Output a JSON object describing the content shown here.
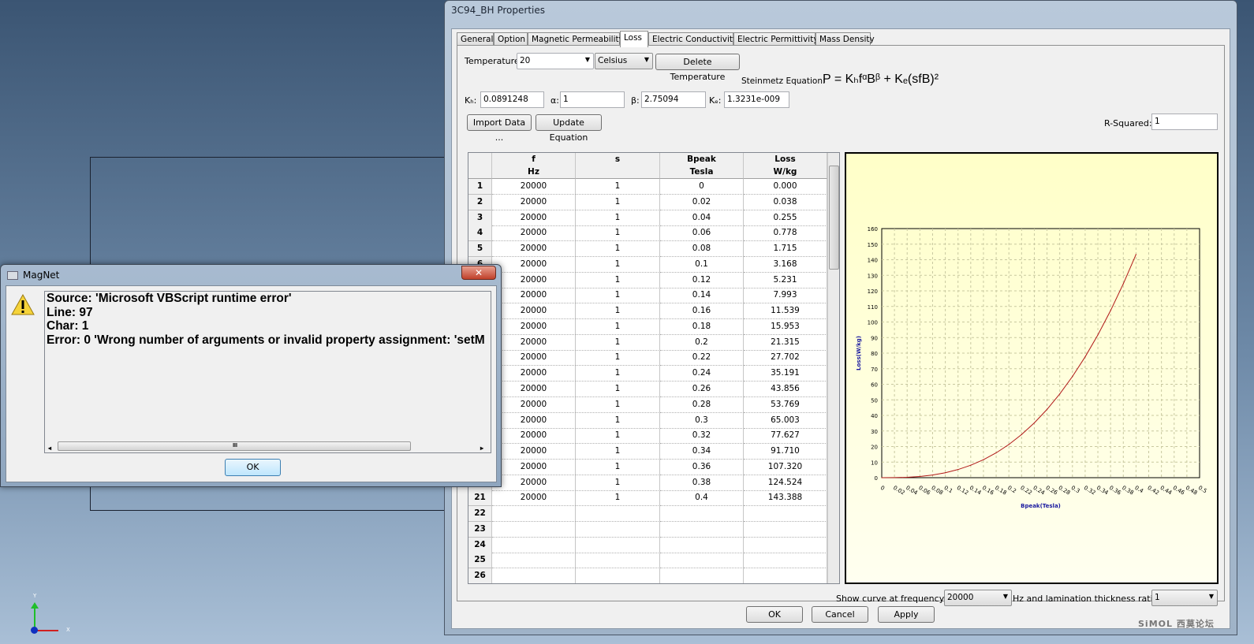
{
  "window": {
    "title": "3C94_BH Properties"
  },
  "tabs": [
    "General",
    "Option",
    "Magnetic Permeability",
    "Loss",
    "Electric Conductivity",
    "Electric Permittivity",
    "Mass Density"
  ],
  "active_tab": "Loss",
  "temperature": {
    "label": "Temperature:",
    "value": "20",
    "unit": "Celsius",
    "delete_label": "Delete Temperature"
  },
  "equation": {
    "label": "Steinmetz Equation:",
    "formula": "P = KₕfᵅBᵝ + Kₑ(sfB)²"
  },
  "params": {
    "kh_label": "Kₕ:",
    "kh": "0.0891248",
    "alpha_label": "α:",
    "alpha": "1",
    "beta_label": "β:",
    "beta": "2.75094",
    "ke_label": "Kₑ:",
    "ke": "1.3231e-009"
  },
  "buttons": {
    "import": "Import Data ...",
    "update": "Update Equation",
    "ok": "OK",
    "cancel": "Cancel",
    "apply": "Apply"
  },
  "rsquared": {
    "label": "R-Squared:",
    "value": "1"
  },
  "table": {
    "columns": [
      {
        "name": "f",
        "unit": "Hz"
      },
      {
        "name": "s",
        "unit": ""
      },
      {
        "name": "Bpeak",
        "unit": "Tesla"
      },
      {
        "name": "Loss",
        "unit": "W/kg"
      }
    ],
    "rows": [
      [
        "20000",
        "1",
        "0",
        "0.000"
      ],
      [
        "20000",
        "1",
        "0.02",
        "0.038"
      ],
      [
        "20000",
        "1",
        "0.04",
        "0.255"
      ],
      [
        "20000",
        "1",
        "0.06",
        "0.778"
      ],
      [
        "20000",
        "1",
        "0.08",
        "1.715"
      ],
      [
        "20000",
        "1",
        "0.1",
        "3.168"
      ],
      [
        "20000",
        "1",
        "0.12",
        "5.231"
      ],
      [
        "20000",
        "1",
        "0.14",
        "7.993"
      ],
      [
        "20000",
        "1",
        "0.16",
        "11.539"
      ],
      [
        "20000",
        "1",
        "0.18",
        "15.953"
      ],
      [
        "20000",
        "1",
        "0.2",
        "21.315"
      ],
      [
        "20000",
        "1",
        "0.22",
        "27.702"
      ],
      [
        "20000",
        "1",
        "0.24",
        "35.191"
      ],
      [
        "20000",
        "1",
        "0.26",
        "43.856"
      ],
      [
        "20000",
        "1",
        "0.28",
        "53.769"
      ],
      [
        "20000",
        "1",
        "0.3",
        "65.003"
      ],
      [
        "20000",
        "1",
        "0.32",
        "77.627"
      ],
      [
        "20000",
        "1",
        "0.34",
        "91.710"
      ],
      [
        "20000",
        "1",
        "0.36",
        "107.320"
      ],
      [
        "20000",
        "1",
        "0.38",
        "124.524"
      ],
      [
        "20000",
        "1",
        "0.4",
        "143.388"
      ]
    ],
    "empty_row_numbers": [
      "22",
      "23",
      "24",
      "25",
      "26"
    ]
  },
  "chart_data": {
    "type": "line",
    "xlabel": "Bpeak(Tesla)",
    "ylabel": "Loss(W/kg)",
    "xlim": [
      0,
      0.5
    ],
    "ylim": [
      0,
      160
    ],
    "x_ticks": [
      "0",
      "0.02",
      "0.04",
      "0.06",
      "0.08",
      "0.1",
      "0.12",
      "0.14",
      "0.16",
      "0.18",
      "0.2",
      "0.22",
      "0.24",
      "0.26",
      "0.28",
      "0.3",
      "0.32",
      "0.34",
      "0.36",
      "0.38",
      "0.4",
      "0.42",
      "0.44",
      "0.46",
      "0.48",
      "0.5"
    ],
    "y_ticks": [
      "0",
      "10",
      "20",
      "30",
      "40",
      "50",
      "60",
      "70",
      "80",
      "90",
      "100",
      "110",
      "120",
      "130",
      "140",
      "150",
      "160"
    ],
    "grid": true,
    "line_color": "#b01818",
    "x": [
      0,
      0.02,
      0.04,
      0.06,
      0.08,
      0.1,
      0.12,
      0.14,
      0.16,
      0.18,
      0.2,
      0.22,
      0.24,
      0.26,
      0.28,
      0.3,
      0.32,
      0.34,
      0.36,
      0.38,
      0.4
    ],
    "y": [
      0,
      0.038,
      0.255,
      0.778,
      1.715,
      3.168,
      5.231,
      7.993,
      11.539,
      15.953,
      21.315,
      27.702,
      35.191,
      43.856,
      53.769,
      65.003,
      77.627,
      91.71,
      107.32,
      124.524,
      143.388
    ]
  },
  "curve_select": {
    "label1": "Show curve at frequency (f)",
    "freq": "20000",
    "label2": "Hz and lamination thickness ratio (s)",
    "ratio": "1"
  },
  "watermark": "SiMOL 西莫论坛",
  "dialog": {
    "title": "MagNet",
    "lines": [
      "Source: 'Microsoft VBScript runtime error'",
      "Line: 97",
      "Char: 1",
      "Error: 0 'Wrong number of arguments or invalid property assignment: 'setM"
    ],
    "ok": "OK",
    "scroll_grip": "III"
  },
  "axis_triad": {
    "y": "Y",
    "x": "X"
  }
}
